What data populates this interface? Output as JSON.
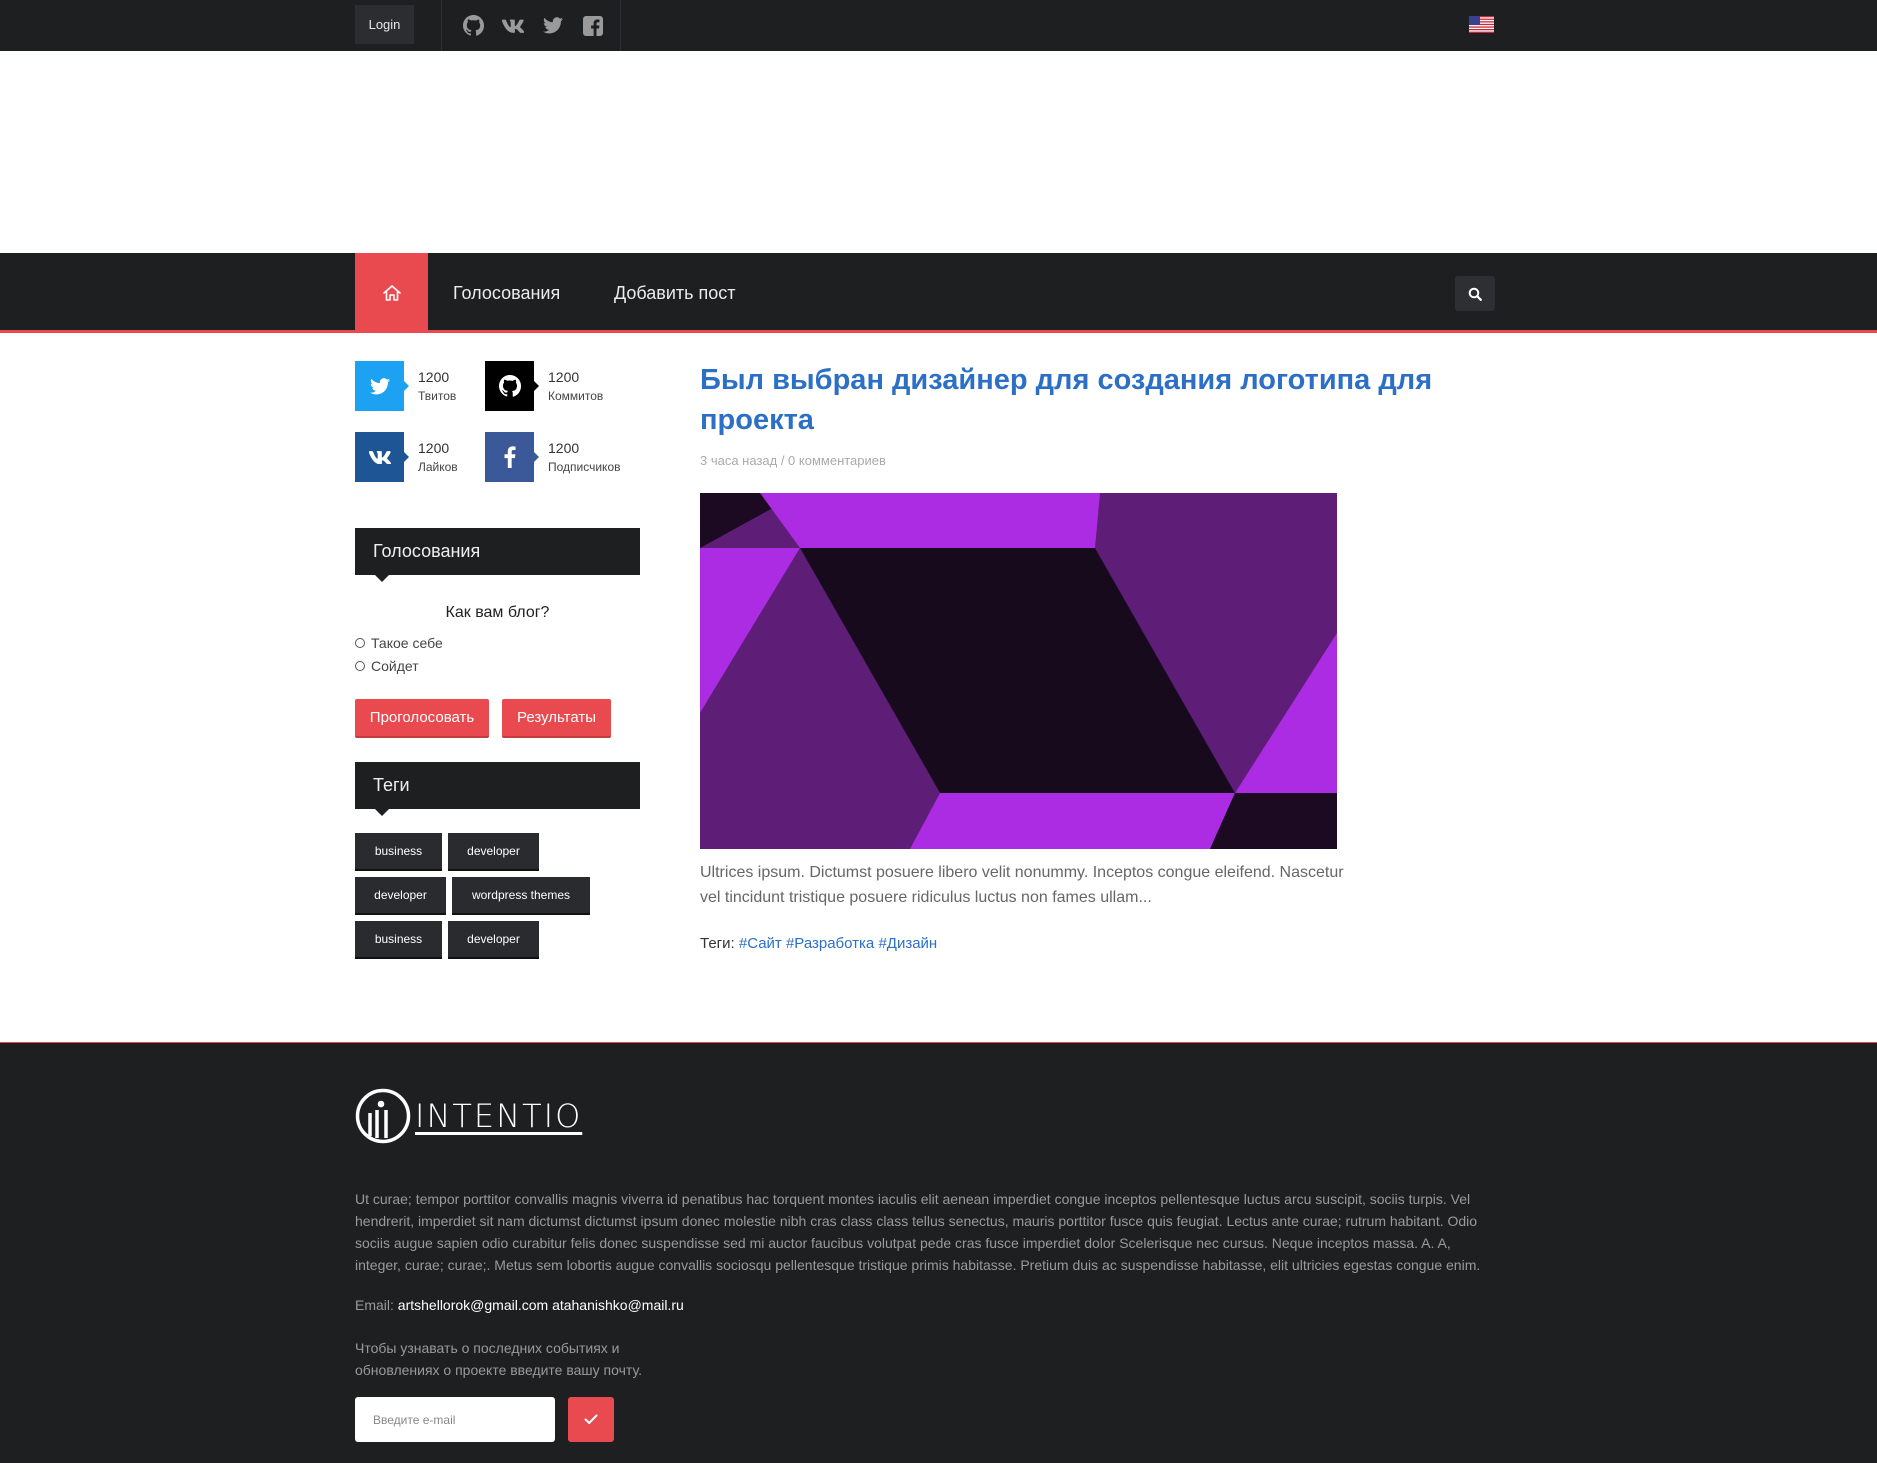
{
  "topbar": {
    "login_label": "Login",
    "social": [
      "github-icon",
      "vk-icon",
      "twitter-icon",
      "facebook-icon"
    ],
    "language": "us-flag-icon"
  },
  "nav": {
    "home_icon": "home-icon",
    "items": [
      "Голосования",
      "Добавить пост"
    ],
    "search_icon": "search-icon"
  },
  "stats": [
    {
      "icon": "twitter-icon",
      "count": "1200",
      "label": "Твитов",
      "color": "#1da1f2"
    },
    {
      "icon": "github-icon",
      "count": "1200",
      "label": "Коммитов",
      "color": "#000000"
    },
    {
      "icon": "vk-icon",
      "count": "1200",
      "label": "Лайков",
      "color": "#1e5595"
    },
    {
      "icon": "facebook-icon",
      "count": "1200",
      "label": "Подписчиков",
      "color": "#3b5998"
    }
  ],
  "poll": {
    "heading": "Голосования",
    "question": "Как вам блог?",
    "options": [
      "Такое себе",
      "Сойдет"
    ],
    "vote_label": "Проголосовать",
    "results_label": "Результаты"
  },
  "tags_widget": {
    "heading": "Теги",
    "tags": [
      "business",
      "developer",
      "developer",
      "wordpress themes",
      "business",
      "developer"
    ]
  },
  "post": {
    "title": "Был выбран дизайнер для создания логотипа для проекта",
    "meta": "3 часа назад / 0 комментариев",
    "excerpt": "Ultrices ipsum. Dictumst posuere libero velit nonummy. Inceptos congue eleifend. Nascetur vel tincidunt tristique posuere ridiculus luctus non fames ullam...",
    "tags_label": "Теги:",
    "tags": [
      "#Сайт",
      "#Разработка",
      "#Дизайн"
    ]
  },
  "footer": {
    "logo_text": "INTENTIO",
    "about": "Ut curae; tempor porttitor convallis magnis viverra id penatibus hac torquent montes iaculis elit aenean imperdiet congue inceptos pellentesque luctus arcu suscipit, sociis turpis. Vel hendrerit, imperdiet sit nam dictumst dictumst ipsum donec molestie nibh cras class class tellus senectus, mauris porttitor fusce quis feugiat. Lectus ante curae; rutrum habitant. Odio sociis augue sapien odio curabitur felis donec suspendisse sed mi auctor faucibus volutpat pede cras fusce imperdiet dolor Scelerisque nec cursus. Neque inceptos massa. A. A, integer, curae; curae;. Metus sem lobortis augue convallis sociosqu pellentesque tristique primis habitasse. Pretium duis ac suspendisse habitasse, elit ultricies egestas congue enim.",
    "email_label": "Email:",
    "email_1": "artshellorok@gmail.com",
    "email_2": "atahanishko@mail.ru",
    "subscribe_text": "Чтобы узнавать о последних событиях и обновлениях о проекте введите вашу почту.",
    "email_placeholder": "Введите e-mail",
    "submit_icon": "check-icon"
  },
  "colors": {
    "accent": "#e84a4f",
    "dark": "#1e1f21",
    "link": "#2b6fc7"
  }
}
